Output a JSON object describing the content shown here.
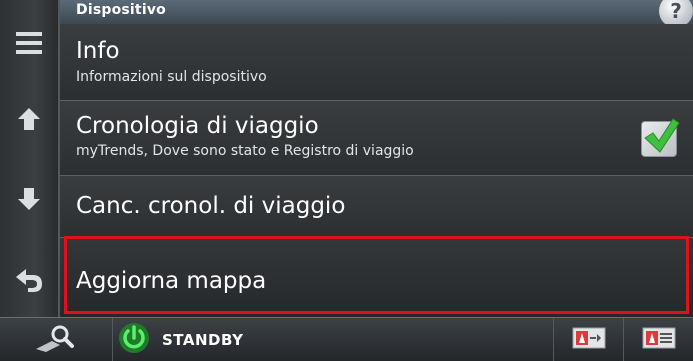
{
  "header": {
    "title": "Dispositivo",
    "help_glyph": "?"
  },
  "list": {
    "items": [
      {
        "title": "Info",
        "subtitle": "Informazioni sul dispositivo"
      },
      {
        "title": "Cronologia di viaggio",
        "subtitle": "myTrends, Dove sono stato e Registro di viaggio",
        "checked": true
      },
      {
        "title": "Canc. cronol. di viaggio"
      },
      {
        "title": "Aggiorna mappa",
        "highlighted": true
      }
    ]
  },
  "left_nav": [
    "menu-icon",
    "arrow-up-icon",
    "arrow-down-icon",
    "back-icon"
  ],
  "bottom_bar": {
    "standby_label": "STANDBY",
    "icons": [
      "search-map-icon",
      "power-icon",
      "media-play-icon",
      "media-list-icon"
    ]
  },
  "colors": {
    "highlight": "#e0101e",
    "check": "#3fbf3f",
    "power": "#2dc53d",
    "header": "#4d5966"
  }
}
